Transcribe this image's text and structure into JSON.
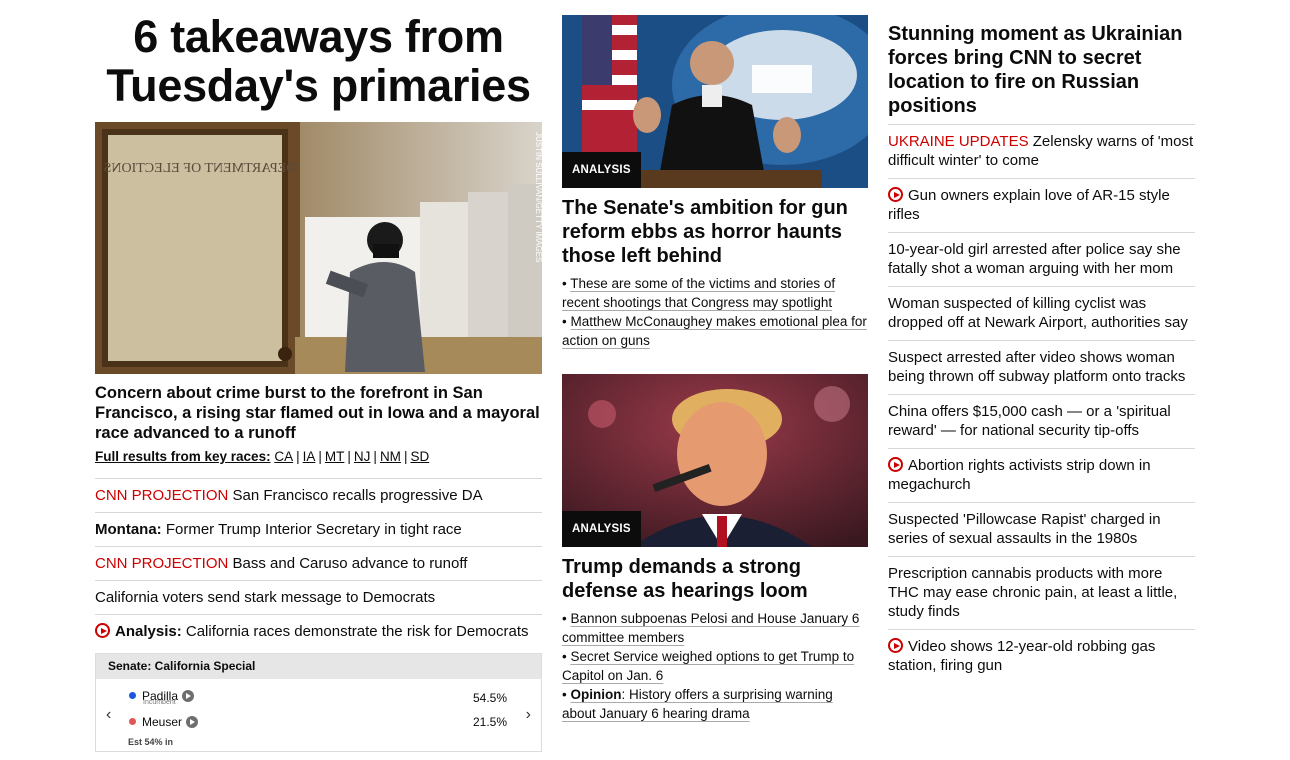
{
  "hero": {
    "title": "6 takeaways from Tuesday's primaries",
    "image_credit": "JUSTIN SULLIVAN/GETTY IMAGES",
    "door_text": "DEPARTMENT OF ELECTIONS",
    "subtitle": "Concern about crime burst to the forefront in San Francisco, a rising star flamed out in Iowa and a mayoral race advanced to a runoff",
    "key_races_label": "Full results from key races:",
    "key_races": [
      "CA",
      "IA",
      "MT",
      "NJ",
      "NM",
      "SD"
    ]
  },
  "left_headlines": [
    {
      "kicker": "CNN PROJECTION",
      "kicker_style": "red",
      "text": "San Francisco recalls progressive DA"
    },
    {
      "kicker": "Montana:",
      "kicker_style": "bold",
      "text": "Former Trump Interior Secretary in tight race"
    },
    {
      "kicker": "CNN PROJECTION",
      "kicker_style": "red",
      "text": "Bass and Caruso advance to runoff"
    },
    {
      "kicker": "",
      "kicker_style": "",
      "text": "California voters send stark message to Democrats"
    },
    {
      "kicker": "Analysis:",
      "kicker_style": "bold",
      "text": "California races demonstrate the risk for Democrats",
      "video": true
    }
  ],
  "race": {
    "title": "Senate: California Special",
    "candidates": [
      {
        "name": "Padilla",
        "note": "Incumbent",
        "pct": "54.5%",
        "color": "#1a56db"
      },
      {
        "name": "Meuser",
        "note": "",
        "pct": "21.5%",
        "color": "#e05555"
      }
    ],
    "estimate": "Est 54% in"
  },
  "middle": {
    "story1": {
      "badge": "ANALYSIS",
      "title": "The Senate's ambition for gun reform ebbs as horror haunts those left behind",
      "bullets": [
        {
          "bold": "",
          "text": "These are some of the victims and stories of recent shootings that Congress may spotlight"
        },
        {
          "bold": "",
          "text": "Matthew McConaughey makes emotional plea for action on guns"
        }
      ]
    },
    "story2": {
      "badge": "ANALYSIS",
      "title": "Trump demands a strong defense as hearings loom",
      "bullets": [
        {
          "bold": "",
          "text": "Bannon subpoenas Pelosi and House January 6 committee members"
        },
        {
          "bold": "",
          "text": "Secret Service weighed options to get Trump to Capitol on Jan. 6"
        },
        {
          "bold": "Opinion",
          "text": ": History offers a surprising warning about January 6 hearing drama"
        }
      ]
    }
  },
  "right": {
    "title": "Stunning moment as Ukrainian forces bring CNN to secret location to fire on Russian positions",
    "items": [
      {
        "kicker": "UKRAINE UPDATES",
        "text": "Zelensky warns of 'most difficult winter' to come",
        "video": false
      },
      {
        "kicker": "",
        "text": "Gun owners explain love of AR-15 style rifles",
        "video": true
      },
      {
        "kicker": "",
        "text": "10-year-old girl arrested after police say she fatally shot a woman arguing with her mom",
        "video": false
      },
      {
        "kicker": "",
        "text": "Woman suspected of killing cyclist was dropped off at Newark Airport, authorities say",
        "video": false
      },
      {
        "kicker": "",
        "text": "Suspect arrested after video shows woman being thrown off subway platform onto tracks",
        "video": false
      },
      {
        "kicker": "",
        "text": "China offers $15,000 cash — or a 'spiritual reward' — for national security tip-offs",
        "video": false
      },
      {
        "kicker": "",
        "text": "Abortion rights activists strip down in megachurch",
        "video": true
      },
      {
        "kicker": "",
        "text": "Suspected 'Pillowcase Rapist' charged in series of sexual assaults in the 1980s",
        "video": false
      },
      {
        "kicker": "",
        "text": "Prescription cannabis products with more THC may ease chronic pain, at least a little, study finds",
        "video": false
      },
      {
        "kicker": "",
        "text": "Video shows 12-year-old robbing gas station, firing gun",
        "video": true
      }
    ]
  },
  "colors": {
    "accent_red": "#cc0000",
    "divider": "#d8d8d8"
  }
}
